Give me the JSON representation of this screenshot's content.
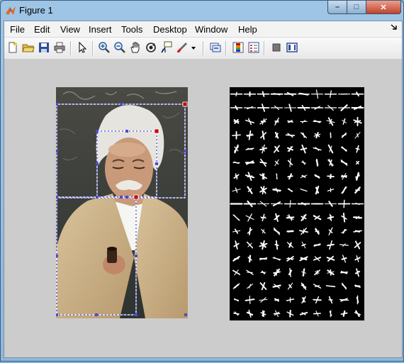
{
  "window": {
    "title": "Figure 1",
    "min_label": "–",
    "max_label": "□",
    "close_label": "✕"
  },
  "menu": {
    "items": [
      "File",
      "Edit",
      "View",
      "Insert",
      "Tools",
      "Desktop",
      "Window",
      "Help"
    ]
  },
  "toolbar": {
    "icons": [
      "new-figure-icon",
      "open-file-icon",
      "save-icon",
      "print-icon",
      "edit-plot-arrow-icon",
      "zoom-in-icon",
      "zoom-out-icon",
      "pan-hand-icon",
      "rotate-3d-icon",
      "data-cursor-icon",
      "brush-icon",
      "brush-dropdown-icon",
      "link-plot-icon",
      "colorbar-icon",
      "legend-icon",
      "hide-plot-tools-icon",
      "show-plot-tools-icon"
    ]
  },
  "colors": {
    "figure_bg": "#cccccc",
    "bbox_white": "#ffffff",
    "bbox_blue": "#4b4bd6",
    "handle_red": "#cc0000"
  }
}
